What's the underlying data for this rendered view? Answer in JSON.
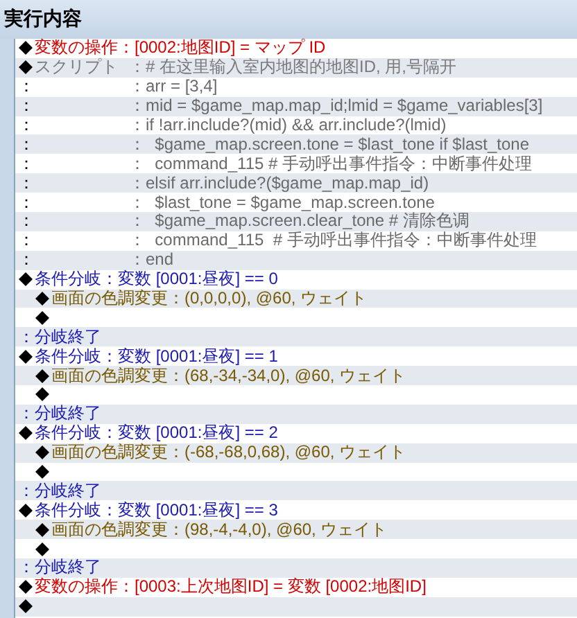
{
  "panel": {
    "title": "実行内容"
  },
  "commands": [
    {
      "kind": "variable",
      "text": "変数の操作：[0002:地图ID] = マップ ID"
    },
    {
      "kind": "script",
      "label": "スクリプト",
      "text": "：# 在这里输入室内地图的地图ID, 用,号隔开",
      "lines": [
        {
          "marker": "：",
          "code": "：arr = [3,4]"
        },
        {
          "marker": "：",
          "code": "：mid = $game_map.map_id;lmid = $game_variables[3]"
        },
        {
          "marker": "：",
          "code": "：if !arr.include?(mid) && arr.include?(lmid)"
        },
        {
          "marker": "：",
          "code": "：  $game_map.screen.tone = $last_tone if $last_tone"
        },
        {
          "marker": "：",
          "code": "：  command_115 # 手动呼出事件指令：中断事件处理"
        },
        {
          "marker": "：",
          "code": "：elsif arr.include?($game_map.map_id)"
        },
        {
          "marker": "：",
          "code": "：  $last_tone = $game_map.screen.tone"
        },
        {
          "marker": "：",
          "code": "：  $game_map.screen.clear_tone # 清除色调"
        },
        {
          "marker": "：",
          "code": "：  command_115  # 手动呼出事件指令：中断事件处理"
        },
        {
          "marker": "：",
          "code": "：end"
        }
      ]
    },
    {
      "kind": "branch",
      "text": "条件分岐：変数 [0001:昼夜] == 0",
      "children": [
        {
          "kind": "tone",
          "text": "画面の色調変更：(0,0,0,0), @60, ウェイト"
        },
        {
          "kind": "empty"
        }
      ]
    },
    {
      "kind": "branch_end",
      "text": "：分岐終了"
    },
    {
      "kind": "branch",
      "text": "条件分岐：変数 [0001:昼夜] == 1",
      "children": [
        {
          "kind": "tone",
          "text": "画面の色調変更：(68,-34,-34,0), @60, ウェイト"
        },
        {
          "kind": "empty"
        }
      ]
    },
    {
      "kind": "branch_end",
      "text": "：分岐終了"
    },
    {
      "kind": "branch",
      "text": "条件分岐：変数 [0001:昼夜] == 2",
      "children": [
        {
          "kind": "tone",
          "text": "画面の色調変更：(-68,-68,0,68), @60, ウェイト"
        },
        {
          "kind": "empty"
        }
      ]
    },
    {
      "kind": "branch_end",
      "text": "：分岐終了"
    },
    {
      "kind": "branch",
      "text": "条件分岐：変数 [0001:昼夜] == 3",
      "children": [
        {
          "kind": "tone",
          "text": "画面の色調変更：(98,-4,-4,0), @60, ウェイト"
        },
        {
          "kind": "empty"
        }
      ]
    },
    {
      "kind": "branch_end",
      "text": "：分岐終了"
    },
    {
      "kind": "variable",
      "text": "変数の操作：[0003:上次地图ID] = 変数 [0002:地图ID]"
    },
    {
      "kind": "empty"
    }
  ]
}
